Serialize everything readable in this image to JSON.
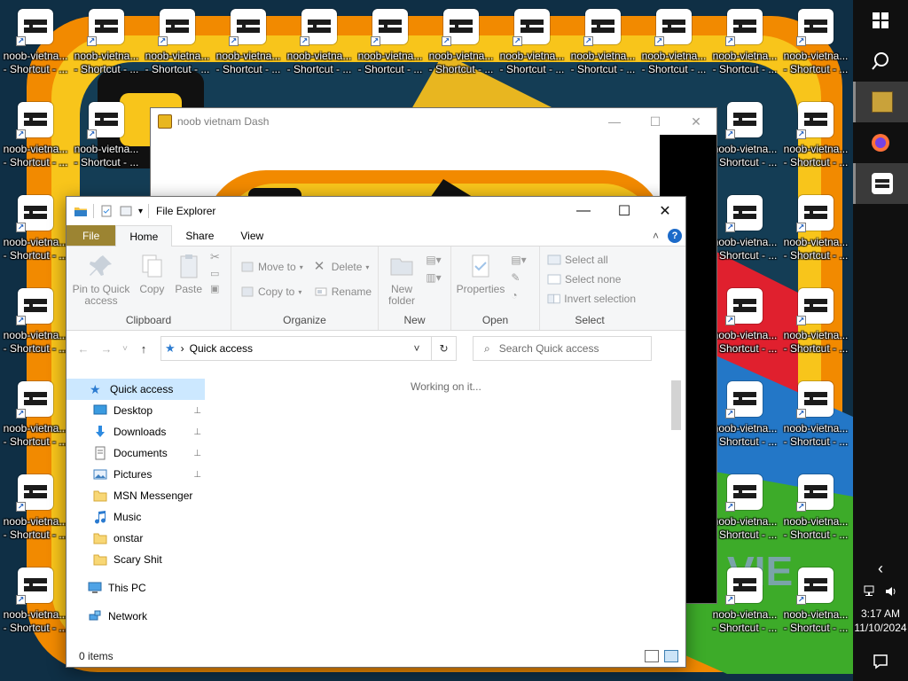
{
  "desktop": {
    "icon_label_line1": "noob-vietna...",
    "icon_label_line2": "- Shortcut - ...",
    "icon_label_alt": "noob-vietna... - Shortcut - ...",
    "icon_name": "noob-vietnam-shortcut-icon",
    "wallpaper_colors": {
      "orange": "#f28a00",
      "yellow": "#f8c51b",
      "teal": "#143d55",
      "red": "#e0202e",
      "green": "#3dab29"
    }
  },
  "game_window": {
    "title": "noob vietnam Dash",
    "minimize_glyph": "—",
    "maximize_glyph": "☐",
    "close_glyph": "✕"
  },
  "explorer": {
    "title": "File Explorer",
    "tabs": {
      "file": "File",
      "home": "Home",
      "share": "Share",
      "view": "View"
    },
    "help_glyph": "?",
    "collapse_glyph": "˄",
    "ribbon": {
      "clipboard": {
        "name": "Clipboard",
        "pin": "Pin to Quick access",
        "copy": "Copy",
        "paste": "Paste"
      },
      "organize": {
        "name": "Organize",
        "move_to": "Move to",
        "copy_to": "Copy to",
        "delete": "Delete",
        "rename": "Rename"
      },
      "new": {
        "name": "New",
        "new_folder": "New folder"
      },
      "open": {
        "name": "Open",
        "properties": "Properties"
      },
      "select": {
        "name": "Select",
        "select_all": "Select all",
        "select_none": "Select none",
        "invert_selection": "Invert selection"
      }
    },
    "address": {
      "back_glyph": "←",
      "forward_glyph": "→",
      "recent_glyph": "˅",
      "up_glyph": "↑",
      "breadcrumb_sep": "›",
      "location": "Quick access",
      "dropdown_glyph": "˅",
      "refresh_glyph": "↻"
    },
    "search": {
      "placeholder": "Search Quick access"
    },
    "nav": {
      "quick_access": "Quick access",
      "items": [
        {
          "label": "Desktop",
          "pinned": true,
          "icon": "desktop-icon"
        },
        {
          "label": "Downloads",
          "pinned": true,
          "icon": "downloads-icon"
        },
        {
          "label": "Documents",
          "pinned": true,
          "icon": "documents-icon"
        },
        {
          "label": "Pictures",
          "pinned": true,
          "icon": "pictures-icon"
        },
        {
          "label": "MSN Messenger",
          "pinned": false,
          "icon": "folder-icon"
        },
        {
          "label": "Music",
          "pinned": false,
          "icon": "music-icon"
        },
        {
          "label": "onstar",
          "pinned": false,
          "icon": "folder-icon"
        },
        {
          "label": "Scary Shit",
          "pinned": false,
          "icon": "folder-icon"
        }
      ],
      "this_pc": "This PC",
      "network": "Network",
      "pin_glyph": "📌"
    },
    "content": {
      "status_message": "Working on it..."
    },
    "status_bar": {
      "item_count": "0 items"
    }
  },
  "taskbar": {
    "time": "3:17 AM",
    "date": "11/10/2024",
    "tray_chevron": "‹",
    "apps": [
      "start-icon",
      "search-icon",
      "game-app-icon",
      "firefox-icon",
      "noob-vietnam-app-icon"
    ]
  }
}
